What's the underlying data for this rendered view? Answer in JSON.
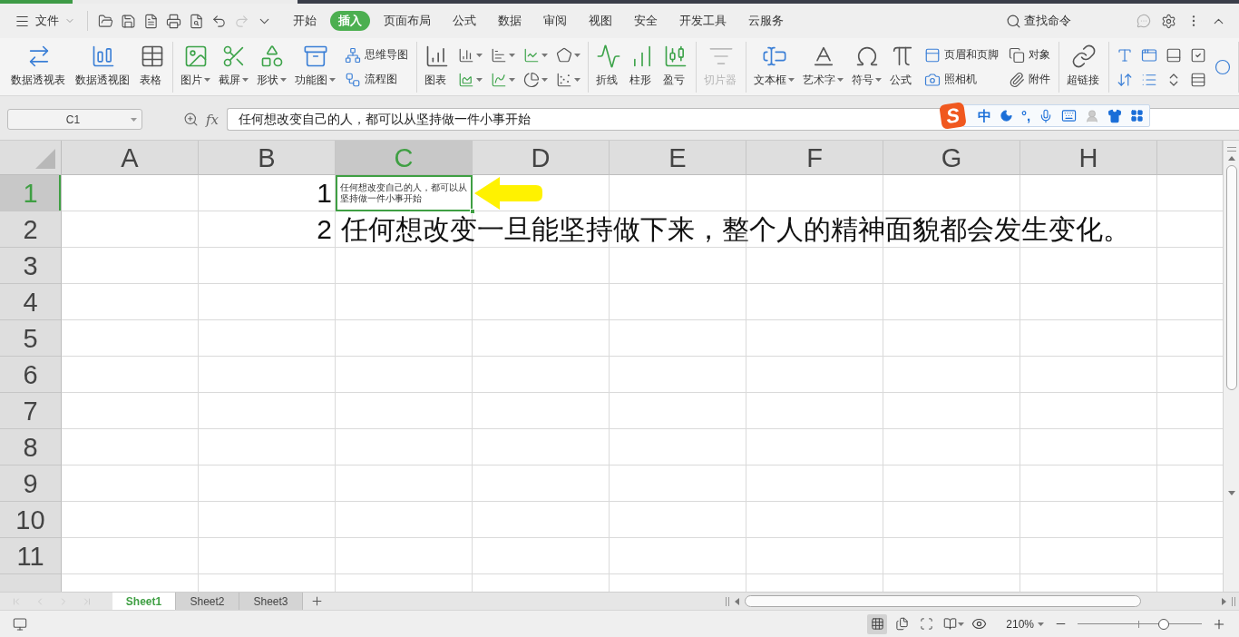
{
  "menu_bar": {
    "file_menu": "文件",
    "quick_access": [
      {
        "disabled": false
      },
      {
        "disabled": false
      },
      {
        "disabled": false
      },
      {
        "disabled": false
      },
      {
        "disabled": false
      },
      {
        "disabled": false
      },
      {
        "disabled": true
      },
      {
        "disabled": false
      }
    ],
    "tabs": [
      {
        "label": "开始",
        "selected": false
      },
      {
        "label": "插入",
        "selected": true
      },
      {
        "label": "页面布局",
        "selected": false
      },
      {
        "label": "公式",
        "selected": false
      },
      {
        "label": "数据",
        "selected": false
      },
      {
        "label": "审阅",
        "selected": false
      },
      {
        "label": "视图",
        "selected": false
      },
      {
        "label": "安全",
        "selected": false
      },
      {
        "label": "开发工具",
        "selected": false
      },
      {
        "label": "云服务",
        "selected": false
      }
    ],
    "search": "查找命令"
  },
  "ribbon": {
    "groups": [
      {
        "columns": [
          {
            "kind": "large",
            "label": "数据透视表",
            "dropdown": false,
            "disabled": false
          },
          {
            "kind": "large",
            "label": "数据透视图",
            "dropdown": false,
            "disabled": false
          },
          {
            "kind": "large",
            "label": "表格",
            "dropdown": false,
            "disabled": false
          }
        ]
      },
      {
        "columns": [
          {
            "kind": "large",
            "label": "图片",
            "dropdown": true,
            "disabled": false
          },
          {
            "kind": "large",
            "label": "截屏",
            "dropdown": true,
            "disabled": false
          },
          {
            "kind": "large",
            "label": "形状",
            "dropdown": true,
            "disabled": false
          },
          {
            "kind": "large",
            "label": "功能图",
            "dropdown": true,
            "disabled": false
          },
          {
            "kind": "stack",
            "items": [
              {
                "kind": "small",
                "label": "思维导图",
                "dropdown": false,
                "disabled": false
              },
              {
                "kind": "small",
                "label": "流程图",
                "dropdown": false,
                "disabled": false
              }
            ]
          }
        ]
      },
      {
        "columns": [
          {
            "kind": "large",
            "label": "图表",
            "dropdown": false,
            "disabled": false
          },
          {
            "kind": "stack",
            "items": [
              {
                "kind": "icon",
                "dropdown": true,
                "disabled": false
              },
              {
                "kind": "icon",
                "dropdown": true,
                "disabled": false
              }
            ]
          },
          {
            "kind": "stack",
            "items": [
              {
                "kind": "icon",
                "dropdown": true,
                "disabled": false
              },
              {
                "kind": "icon",
                "dropdown": true,
                "disabled": false
              }
            ]
          },
          {
            "kind": "stack",
            "items": [
              {
                "kind": "icon",
                "dropdown": true,
                "disabled": false
              },
              {
                "kind": "icon",
                "dropdown": true,
                "disabled": false
              }
            ]
          },
          {
            "kind": "stack",
            "items": [
              {
                "kind": "icon",
                "dropdown": true,
                "disabled": false
              },
              {
                "kind": "icon",
                "dropdown": true,
                "disabled": false
              }
            ]
          }
        ]
      },
      {
        "columns": [
          {
            "kind": "large",
            "label": "折线",
            "dropdown": false,
            "disabled": false
          },
          {
            "kind": "large",
            "label": "柱形",
            "dropdown": false,
            "disabled": false
          },
          {
            "kind": "large",
            "label": "盈亏",
            "dropdown": false,
            "disabled": false
          }
        ]
      },
      {
        "columns": [
          {
            "kind": "large",
            "label": "切片器",
            "dropdown": false,
            "disabled": true
          }
        ]
      },
      {
        "columns": [
          {
            "kind": "large",
            "label": "文本框",
            "dropdown": true,
            "disabled": false
          },
          {
            "kind": "large",
            "label": "艺术字",
            "dropdown": true,
            "disabled": false
          },
          {
            "kind": "large",
            "label": "符号",
            "dropdown": true,
            "disabled": false
          },
          {
            "kind": "large",
            "label": "公式",
            "dropdown": false,
            "disabled": false
          },
          {
            "kind": "stack",
            "items": [
              {
                "kind": "small",
                "label": "页眉和页脚",
                "dropdown": false,
                "disabled": false
              },
              {
                "kind": "small",
                "label": "照相机",
                "dropdown": false,
                "disabled": false
              }
            ]
          },
          {
            "kind": "stack",
            "items": [
              {
                "kind": "small",
                "label": "对象",
                "dropdown": false,
                "disabled": false
              },
              {
                "kind": "small",
                "label": "附件",
                "dropdown": false,
                "disabled": false
              }
            ]
          }
        ]
      },
      {
        "columns": [
          {
            "kind": "large",
            "label": "超链接",
            "dropdown": false,
            "disabled": false
          }
        ]
      },
      {
        "columns": [
          {
            "kind": "stack",
            "items": [
              {
                "kind": "icon",
                "dropdown": false,
                "disabled": false
              },
              {
                "kind": "icon",
                "dropdown": false,
                "disabled": false
              }
            ]
          },
          {
            "kind": "stack",
            "items": [
              {
                "kind": "icon",
                "dropdown": false,
                "disabled": false
              },
              {
                "kind": "icon",
                "dropdown": false,
                "disabled": false
              }
            ]
          },
          {
            "kind": "stack",
            "items": [
              {
                "kind": "icon",
                "dropdown": false,
                "disabled": false
              },
              {
                "kind": "icon",
                "dropdown": false,
                "disabled": false
              }
            ]
          },
          {
            "kind": "stack",
            "items": [
              {
                "kind": "icon",
                "dropdown": false,
                "disabled": false
              },
              {
                "kind": "icon",
                "dropdown": false,
                "disabled": false
              }
            ]
          },
          {
            "kind": "stack",
            "items": [
              {
                "kind": "icon",
                "dropdown": false,
                "disabled": false
              }
            ]
          }
        ]
      }
    ]
  },
  "formula_bar": {
    "name_box": "C1",
    "function_label": "fx",
    "value": "任何想改变自己的人，都可以从坚持做一件小事开始"
  },
  "ime_toolbar": {
    "logo": "S",
    "mode": "中",
    "punctuation": "°,"
  },
  "sheet": {
    "columns": [
      {
        "label": "A",
        "selected": false
      },
      {
        "label": "B",
        "selected": false
      },
      {
        "label": "C",
        "selected": true
      },
      {
        "label": "D",
        "selected": false
      },
      {
        "label": "E",
        "selected": false
      },
      {
        "label": "F",
        "selected": false
      },
      {
        "label": "G",
        "selected": false
      },
      {
        "label": "H",
        "selected": false
      }
    ],
    "rows": [
      {
        "label": "1",
        "selected": true,
        "column_b": {
          "value": "1",
          "selected": false
        },
        "column_c": {
          "value": "任何想改变自己的人，都可以从坚持做一件小事开始",
          "selected": true
        }
      },
      {
        "label": "2",
        "selected": false,
        "column_b": {
          "value": "2",
          "selected": false
        },
        "column_c": {
          "value": "任何想改变一旦能坚持做下来，整个人的精神面貌都会发生变化。",
          "selected": false
        }
      },
      {
        "label": "3",
        "selected": false
      },
      {
        "label": "4",
        "selected": false
      },
      {
        "label": "5",
        "selected": false
      },
      {
        "label": "6",
        "selected": false
      },
      {
        "label": "7",
        "selected": false
      },
      {
        "label": "8",
        "selected": false
      },
      {
        "label": "9",
        "selected": false
      },
      {
        "label": "10",
        "selected": false
      },
      {
        "label": "11",
        "selected": false
      }
    ]
  },
  "sheet_tabs": {
    "navigation": [
      {
        "disabled": true
      },
      {
        "disabled": true
      },
      {
        "disabled": true
      },
      {
        "disabled": true
      }
    ],
    "tabs": [
      {
        "label": "Sheet1",
        "selected": true
      },
      {
        "label": "Sheet2",
        "selected": false
      },
      {
        "label": "Sheet3",
        "selected": false
      }
    ]
  },
  "status_bar": {
    "views": [
      {
        "selected": true
      },
      {
        "selected": false
      },
      {
        "selected": false
      },
      {
        "selected": false
      }
    ],
    "zoom": "210%",
    "zoom_slider": {
      "level": 0.69
    }
  }
}
